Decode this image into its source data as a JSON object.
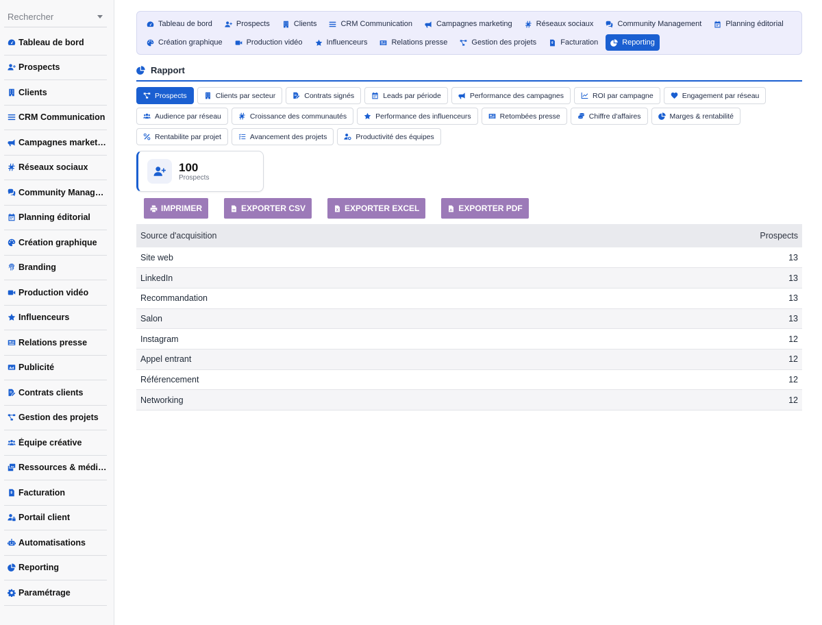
{
  "sidebar": {
    "search_placeholder": "Rechercher",
    "items": [
      {
        "label": "Tableau de bord",
        "icon": "dashboard-icon"
      },
      {
        "label": "Prospects",
        "icon": "user-plus-icon"
      },
      {
        "label": "Clients",
        "icon": "building-icon"
      },
      {
        "label": "CRM Communication",
        "icon": "list-icon"
      },
      {
        "label": "Campagnes marketing",
        "icon": "megaphone-icon"
      },
      {
        "label": "Réseaux sociaux",
        "icon": "hashtag-icon"
      },
      {
        "label": "Community Manage...",
        "icon": "comments-icon"
      },
      {
        "label": "Planning éditorial",
        "icon": "calendar-icon"
      },
      {
        "label": "Création graphique",
        "icon": "palette-icon"
      },
      {
        "label": "Branding",
        "icon": "fingerprint-icon"
      },
      {
        "label": "Production vidéo",
        "icon": "video-icon"
      },
      {
        "label": "Influenceurs",
        "icon": "star-icon"
      },
      {
        "label": "Relations presse",
        "icon": "newspaper-icon"
      },
      {
        "label": "Publicité",
        "icon": "ad-icon"
      },
      {
        "label": "Contrats clients",
        "icon": "contract-icon"
      },
      {
        "label": "Gestion des projets",
        "icon": "project-diagram-icon"
      },
      {
        "label": "Équipe créative",
        "icon": "users-icon"
      },
      {
        "label": "Ressources & médias",
        "icon": "photo-video-icon"
      },
      {
        "label": "Facturation",
        "icon": "invoice-icon"
      },
      {
        "label": "Portail client",
        "icon": "user-lock-icon"
      },
      {
        "label": "Automatisations",
        "icon": "robot-icon"
      },
      {
        "label": "Reporting",
        "icon": "chart-pie-icon"
      },
      {
        "label": "Paramétrage",
        "icon": "cog-icon"
      }
    ]
  },
  "topnav": {
    "items": [
      {
        "label": "Tableau de bord",
        "icon": "dashboard-icon"
      },
      {
        "label": "Prospects",
        "icon": "user-plus-icon"
      },
      {
        "label": "Clients",
        "icon": "building-icon"
      },
      {
        "label": "CRM Communication",
        "icon": "list-icon"
      },
      {
        "label": "Campagnes marketing",
        "icon": "megaphone-icon"
      },
      {
        "label": "Réseaux sociaux",
        "icon": "hashtag-icon"
      },
      {
        "label": "Community Management",
        "icon": "comments-icon"
      },
      {
        "label": "Planning éditorial",
        "icon": "calendar-icon"
      },
      {
        "label": "Création graphique",
        "icon": "palette-icon"
      },
      {
        "label": "Production vidéo",
        "icon": "video-icon"
      },
      {
        "label": "Influenceurs",
        "icon": "star-icon"
      },
      {
        "label": "Relations presse",
        "icon": "newspaper-icon"
      },
      {
        "label": "Gestion des projets",
        "icon": "project-diagram-icon"
      },
      {
        "label": "Facturation",
        "icon": "invoice-icon"
      },
      {
        "label": "Reporting",
        "icon": "chart-pie-icon",
        "active": true
      }
    ]
  },
  "report": {
    "section_title": "Rapport",
    "tabs": [
      {
        "label": "Prospects",
        "icon": "project-diagram-icon",
        "active": true
      },
      {
        "label": "Clients par secteur",
        "icon": "building-icon"
      },
      {
        "label": "Contrats signés",
        "icon": "contract-icon"
      },
      {
        "label": "Leads par période",
        "icon": "calendar-icon"
      },
      {
        "label": "Performance des campagnes",
        "icon": "megaphone-icon"
      },
      {
        "label": "ROI par campagne",
        "icon": "chart-line-icon"
      },
      {
        "label": "Engagement par réseau",
        "icon": "heart-icon"
      },
      {
        "label": "Audience par réseau",
        "icon": "users-icon"
      },
      {
        "label": "Croissance des communautés",
        "icon": "hashtag-icon"
      },
      {
        "label": "Performance des influenceurs",
        "icon": "star-icon"
      },
      {
        "label": "Retombées presse",
        "icon": "newspaper-icon"
      },
      {
        "label": "Chiffre d'affaires",
        "icon": "coins-icon"
      },
      {
        "label": "Marges & rentabilité",
        "icon": "chart-pie-icon"
      },
      {
        "label": "Rentabilite par projet",
        "icon": "percent-icon"
      },
      {
        "label": "Avancement des projets",
        "icon": "tasks-icon"
      },
      {
        "label": "Productivité des équipes",
        "icon": "user-cog-icon"
      }
    ],
    "stat": {
      "value": "100",
      "label": "Prospects",
      "icon": "user-plus-icon"
    },
    "exports": [
      {
        "label": "IMPRIMER",
        "icon": "print-icon"
      },
      {
        "label": "EXPORTER CSV",
        "icon": "file-csv-icon"
      },
      {
        "label": "EXPORTER EXCEL",
        "icon": "file-excel-icon"
      },
      {
        "label": "EXPORTER PDF",
        "icon": "file-pdf-icon"
      }
    ],
    "table": {
      "headers": [
        "Source d'acquisition",
        "Prospects"
      ],
      "rows": [
        [
          "Site web",
          "13"
        ],
        [
          "LinkedIn",
          "13"
        ],
        [
          "Recommandation",
          "13"
        ],
        [
          "Salon",
          "13"
        ],
        [
          "Instagram",
          "12"
        ],
        [
          "Appel entrant",
          "12"
        ],
        [
          "Référencement",
          "12"
        ],
        [
          "Networking",
          "12"
        ]
      ]
    }
  },
  "colors": {
    "accent": "#1a5fd1",
    "export_button": "#9c7ab8",
    "nav_bg": "#eeeefc"
  }
}
